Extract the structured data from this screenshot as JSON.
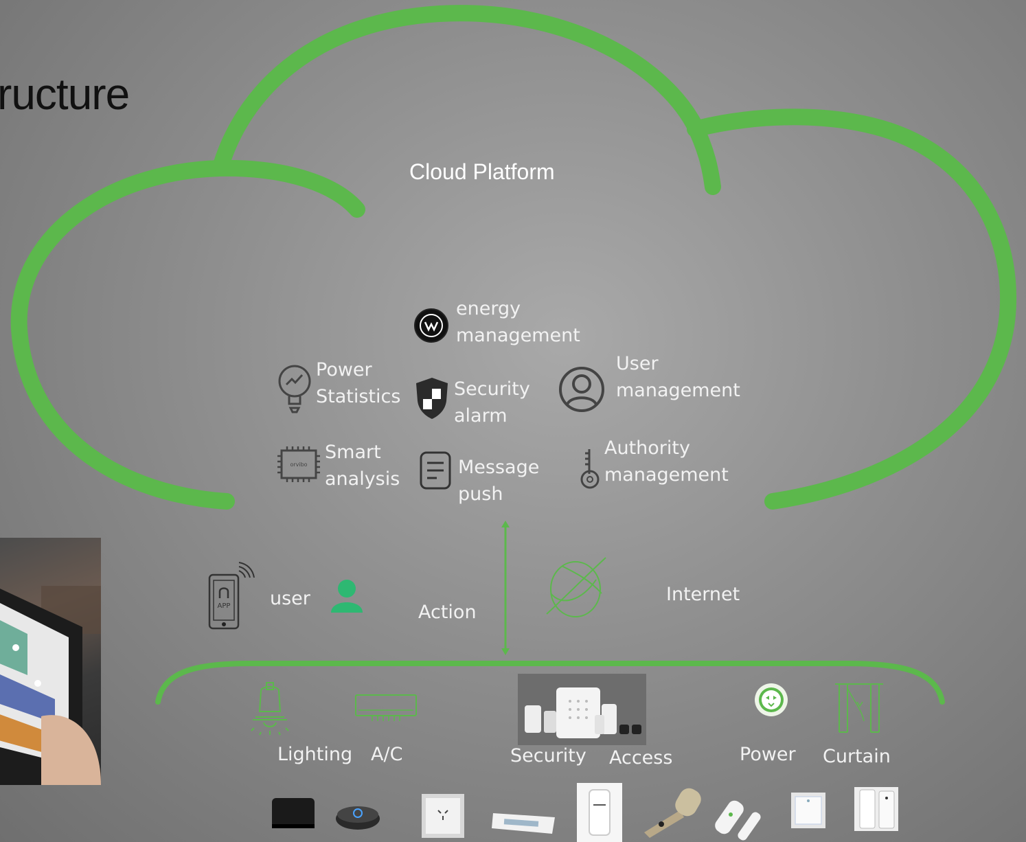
{
  "page": {
    "title_fragment": "ructure"
  },
  "cloud": {
    "title": "Cloud Platform",
    "features": [
      {
        "id": "energy",
        "line1": "energy",
        "line2": "management",
        "icon": "energy-icon"
      },
      {
        "id": "power",
        "line1": "Power",
        "line2": "Statistics",
        "icon": "power-stats-icon"
      },
      {
        "id": "security",
        "line1": "Security",
        "line2": "alarm",
        "icon": "shield-icon"
      },
      {
        "id": "user",
        "line1": "User",
        "line2": "management",
        "icon": "user-circle-icon"
      },
      {
        "id": "smart",
        "line1": "Smart",
        "line2": "analysis",
        "icon": "chip-icon",
        "chip_text": "orvibo"
      },
      {
        "id": "message",
        "line1": "Message",
        "line2": "push",
        "icon": "document-icon"
      },
      {
        "id": "authority",
        "line1": "Authority",
        "line2": "management",
        "icon": "key-icon"
      }
    ]
  },
  "middle": {
    "app_text": "APP",
    "user_label": "user",
    "action_label": "Action",
    "internet_label": "Internet"
  },
  "devices": {
    "categories": [
      {
        "id": "lighting",
        "label": "Lighting"
      },
      {
        "id": "ac",
        "label": "A/C"
      },
      {
        "id": "security",
        "label": "Security"
      },
      {
        "id": "access",
        "label": "Access"
      },
      {
        "id": "power",
        "label": "Power"
      },
      {
        "id": "curtain",
        "label": "Curtain"
      }
    ]
  },
  "colors": {
    "accent_green": "#5cb84c",
    "user_green": "#2eb872",
    "text_light": "#f2f2f2",
    "icon_dark": "#3a3a3a"
  }
}
